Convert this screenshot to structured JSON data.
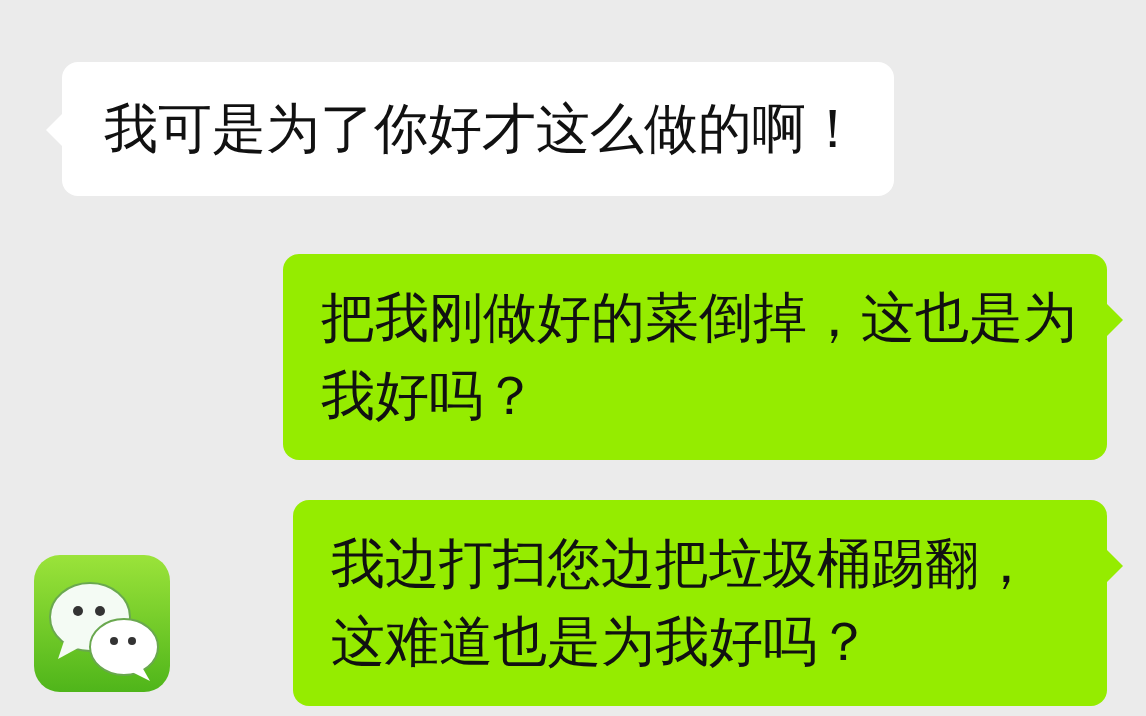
{
  "messages": [
    {
      "kind": "incoming",
      "text": "我可是为了你好才这么做的啊！"
    },
    {
      "kind": "outgoing",
      "text": "把我刚做好的菜倒掉，这也是为我好吗？"
    },
    {
      "kind": "outgoing",
      "text": "我边打扫您边把垃圾桶踢翻，这难道也是为我好吗？"
    }
  ]
}
